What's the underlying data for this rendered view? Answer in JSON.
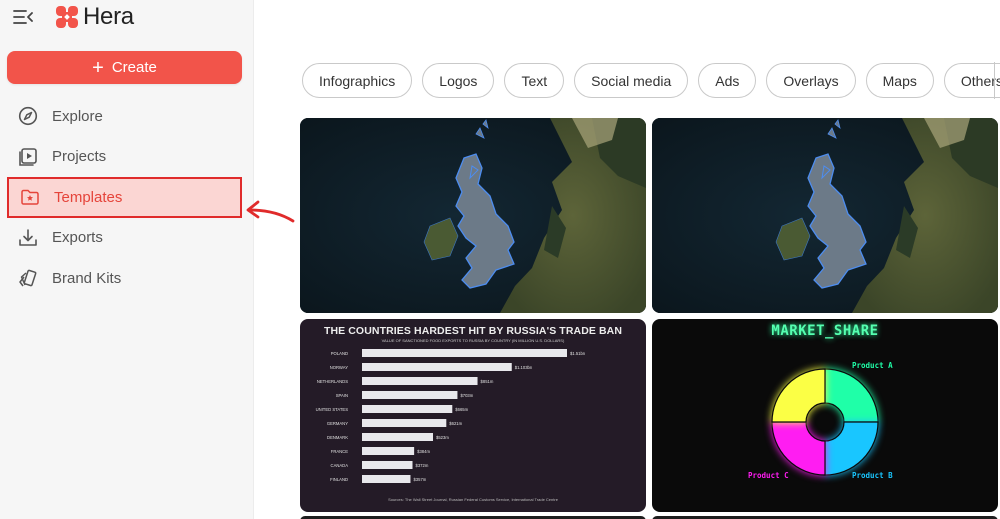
{
  "app": {
    "name": "Hera"
  },
  "sidebar": {
    "create_label": "Create",
    "items": [
      {
        "label": "Explore",
        "icon": "compass-icon",
        "active": false
      },
      {
        "label": "Projects",
        "icon": "play-square-icon",
        "active": false
      },
      {
        "label": "Templates",
        "icon": "folder-star-icon",
        "active": true
      },
      {
        "label": "Exports",
        "icon": "download-icon",
        "active": false
      },
      {
        "label": "Brand Kits",
        "icon": "brand-kits-icon",
        "active": false
      }
    ]
  },
  "annotation": {
    "arrow_color": "#e02b2b",
    "target": "Templates"
  },
  "categories": [
    "Infographics",
    "Logos",
    "Text",
    "Social media",
    "Ads",
    "Overlays",
    "Maps",
    "Others"
  ],
  "colors": {
    "accent": "#f2544a",
    "active_bg": "#fbd6d3",
    "active_text": "#e5443a"
  },
  "templates": {
    "map_card_1": {
      "kind": "map",
      "subject": "United Kingdom highlighted on satellite map"
    },
    "map_card_2": {
      "kind": "map",
      "subject": "United Kingdom highlighted on satellite map"
    },
    "bar_card": {
      "title": "THE COUNTRIES HARDEST HIT BY RUSSIA'S TRADE BAN",
      "subtitle": "VALUE OF SANCTIONED FOOD EXPORTS TO RUSSIA BY COUNTRY (IN MILLION U.S. DOLLARS)",
      "source": "Sources: The Wall Street Journal, Russian Federal Customs Service, International Trade Centre"
    },
    "donut_card": {
      "title": "MARKET_SHARE"
    }
  },
  "chart_data": [
    {
      "type": "bar",
      "title": "THE COUNTRIES HARDEST HIT BY RUSSIA'S TRADE BAN",
      "subtitle": "VALUE OF SANCTIONED FOOD EXPORTS TO RUSSIA BY COUNTRY (IN MILLION U.S. DOLLARS)",
      "categories": [
        "POLAND",
        "NORWAY",
        "NETHERLANDS",
        "SPAIN",
        "UNITED STATES",
        "GERMANY",
        "DENMARK",
        "FRANCE",
        "CANADA",
        "FINLAND"
      ],
      "values": [
        1510,
        1103,
        851,
        703,
        665,
        621,
        523,
        384,
        372,
        357
      ],
      "labels": [
        "$1.51bn",
        "$1.103bn",
        "$851m",
        "$703m",
        "$665m",
        "$621m",
        "$523m",
        "$384m",
        "$372m",
        "$357m"
      ],
      "bar_color": "#e8e8ec"
    },
    {
      "type": "pie",
      "title": "MARKET_SHARE",
      "categories": [
        "Product A",
        "Product B",
        "Product C",
        ""
      ],
      "values": [
        25,
        25,
        25,
        25
      ],
      "colors": [
        "#1fffa8",
        "#19c6ff",
        "#ff1df2",
        "#fbff45"
      ]
    }
  ]
}
